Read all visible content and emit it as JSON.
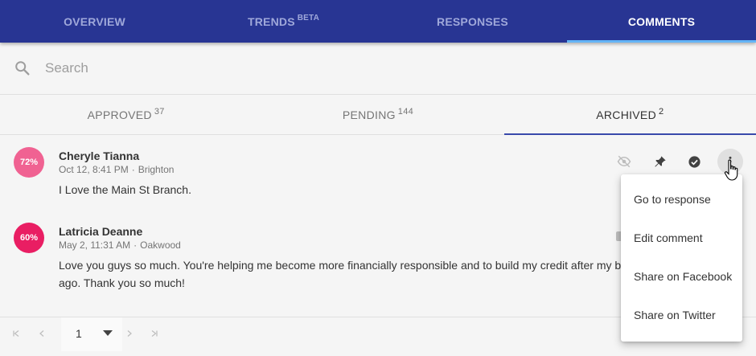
{
  "nav": {
    "tabs": [
      {
        "label": "OVERVIEW"
      },
      {
        "label": "TRENDS",
        "badge": "BETA"
      },
      {
        "label": "RESPONSES"
      },
      {
        "label": "COMMENTS"
      }
    ],
    "active": "COMMENTS"
  },
  "search": {
    "placeholder": "Search",
    "icon": "search-icon"
  },
  "subtabs": [
    {
      "label": "APPROVED",
      "count": "37"
    },
    {
      "label": "PENDING",
      "count": "144"
    },
    {
      "label": "ARCHIVED",
      "count": "2"
    }
  ],
  "comments": [
    {
      "score": "72%",
      "name": "Cheryle Tianna",
      "date": "Oct 12, 8:41 PM",
      "separator": "·",
      "location": "Brighton",
      "text": "I Love the Main St Branch.",
      "color": "#f06292"
    },
    {
      "score": "60%",
      "name": "Latricia Deanne",
      "date": "May 2, 11:31 AM",
      "separator": "·",
      "location": "Oakwood",
      "text": "Love you guys so much. You're helping me become more financially responsible and to build my credit after my b",
      "text_line2": "ago. Thank you so much!",
      "color": "#e91e63"
    }
  ],
  "actions": [
    "hide-icon",
    "pin-icon",
    "check-circle-icon",
    "more-vert-icon"
  ],
  "menu": {
    "items": [
      "Go to response",
      "Edit comment",
      "Share on Facebook",
      "Share on Twitter"
    ]
  },
  "pager": {
    "page": "1"
  },
  "colors": {
    "nav_bg": "#283593",
    "nav_accent": "#64b5f6",
    "tab_underline": "#3949ab"
  }
}
